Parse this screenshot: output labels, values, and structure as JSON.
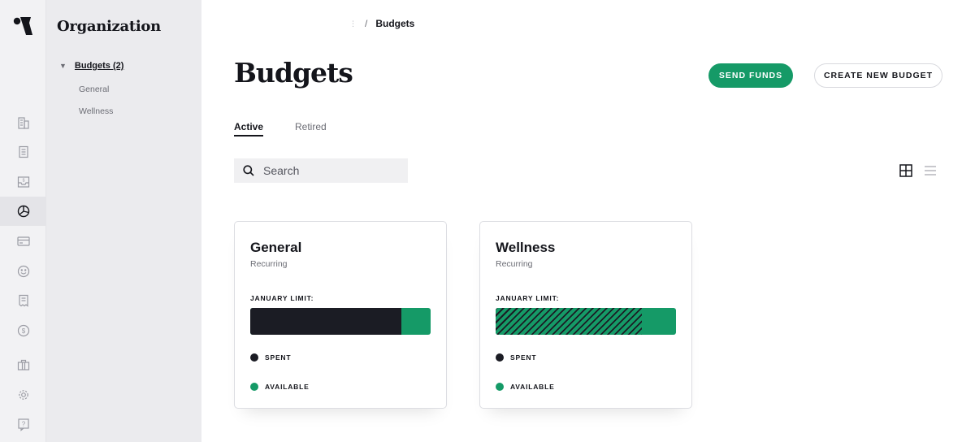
{
  "org_sidebar": {
    "title": "Organization",
    "parent_label": "Budgets (2)",
    "children": [
      "General",
      "Wellness"
    ]
  },
  "rail_icons": [
    "building-icon",
    "document-icon",
    "inbox-dollar-icon",
    "pie-chart-icon",
    "credit-card-icon",
    "smiley-icon",
    "receipt-icon",
    "dollar-circle-icon",
    "briefcase-icon",
    "gear-icon",
    "help-icon"
  ],
  "breadcrumb": {
    "current": "Budgets"
  },
  "page": {
    "title": "Budgets",
    "send_funds_label": "SEND FUNDS",
    "create_budget_label": "CREATE NEW BUDGET"
  },
  "tabs": [
    {
      "label": "Active",
      "active": true
    },
    {
      "label": "Retired",
      "active": false
    }
  ],
  "search": {
    "placeholder": "Search"
  },
  "colors": {
    "accent": "#159a67",
    "dark": "#1b1c24"
  },
  "cards": [
    {
      "name": "General",
      "frequency": "Recurring",
      "limit_label": "JANUARY LIMIT:",
      "spent_fraction": 0.84,
      "fill_style": "solid",
      "spent_label": "SPENT",
      "available_label": "AVAILABLE"
    },
    {
      "name": "Wellness",
      "frequency": "Recurring",
      "limit_label": "JANUARY LIMIT:",
      "spent_fraction": 0.81,
      "fill_style": "hatched",
      "spent_label": "SPENT",
      "available_label": "AVAILABLE"
    }
  ]
}
